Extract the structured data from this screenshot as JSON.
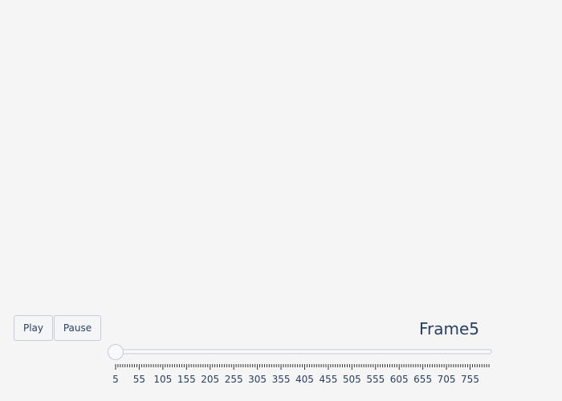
{
  "animation_controls": {
    "play_label": "Play",
    "pause_label": "Pause"
  },
  "slider": {
    "current_label": "Frame5",
    "current_value": 5,
    "min": 5,
    "max": 800,
    "step": 5,
    "tick_labels": [
      "5",
      "55",
      "105",
      "155",
      "205",
      "255",
      "305",
      "355",
      "405",
      "455",
      "505",
      "555",
      "605",
      "655",
      "705",
      "755"
    ]
  },
  "colors": {
    "background": "#f5f5f6",
    "text": "#2a3f5f",
    "border": "#c6cbd5"
  }
}
